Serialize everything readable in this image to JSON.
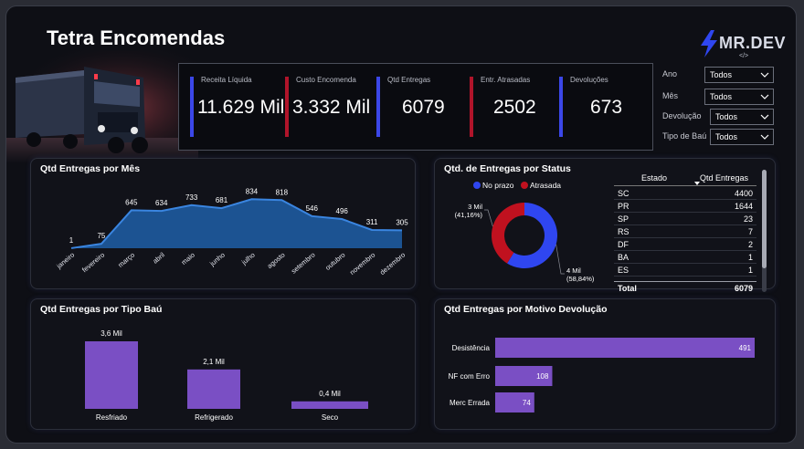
{
  "header": {
    "title": "Tetra Encomendas",
    "logo": "MR.DEV",
    "logo_sub": "</>"
  },
  "kpis": [
    {
      "label": "Receita Líquida",
      "value": "11.629 Mil",
      "color": "#3b47e8"
    },
    {
      "label": "Custo Encomenda",
      "value": "3.332 Mil",
      "color": "#b0142a"
    },
    {
      "label": "Qtd Entregas",
      "value": "6079",
      "color": "#3b47e8"
    },
    {
      "label": "Entr. Atrasadas",
      "value": "2502",
      "color": "#b0142a"
    },
    {
      "label": "Devoluções",
      "value": "673",
      "color": "#3b47e8"
    }
  ],
  "filters": [
    {
      "label": "Ano",
      "value": "Todos"
    },
    {
      "label": "Mês",
      "value": "Todos"
    },
    {
      "label": "Devolução",
      "value": "Todos"
    },
    {
      "label": "Tipo de Baú",
      "value": "Todos"
    }
  ],
  "panels": {
    "monthly": {
      "title": "Qtd Entregas por Mês"
    },
    "status": {
      "title": "Qtd. de Entregas por Status"
    },
    "tipo": {
      "title": "Qtd Entregas por Tipo Baú"
    },
    "motivo": {
      "title": "Qtd Entregas por Motivo Devolução"
    }
  },
  "chart_data": [
    {
      "type": "area",
      "title": "Qtd Entregas por Mês",
      "categories": [
        "janeiro",
        "fevereiro",
        "março",
        "abril",
        "maio",
        "junho",
        "julho",
        "agosto",
        "setembro",
        "outubro",
        "novembro",
        "dezembro"
      ],
      "values": [
        1,
        75,
        645,
        634,
        733,
        681,
        834,
        818,
        546,
        496,
        311,
        305
      ],
      "ylim": [
        0,
        900
      ],
      "color": "#1f5fa8",
      "grid": false
    },
    {
      "type": "pie",
      "title": "Qtd. de Entregas por Status",
      "legend": "top",
      "slices": [
        {
          "name": "No prazo",
          "value": 3577,
          "label": "4 Mil",
          "pct": "(58,84%)",
          "color": "#2f46f0"
        },
        {
          "name": "Atrasada",
          "value": 2502,
          "label": "3 Mil",
          "pct": "(41,16%)",
          "color": "#c0111f"
        }
      ]
    },
    {
      "type": "table",
      "columns": [
        "Estado",
        "Qtd Entregas"
      ],
      "rows": [
        [
          "SC",
          "4400"
        ],
        [
          "PR",
          "1644"
        ],
        [
          "SP",
          "23"
        ],
        [
          "RS",
          "7"
        ],
        [
          "DF",
          "2"
        ],
        [
          "BA",
          "1"
        ],
        [
          "ES",
          "1"
        ]
      ],
      "total": [
        "Total",
        "6079"
      ]
    },
    {
      "type": "bar",
      "title": "Qtd Entregas por Tipo Baú",
      "categories": [
        "Resfriado",
        "Refrigerado",
        "Seco"
      ],
      "values": [
        3600,
        2100,
        400
      ],
      "labels": [
        "3,6 Mil",
        "2,1 Mil",
        "0,4 Mil"
      ],
      "color": "#7a4fc4"
    },
    {
      "type": "bar",
      "orientation": "horizontal",
      "title": "Qtd Entregas por Motivo Devolução",
      "categories": [
        "Desistência",
        "NF com Erro",
        "Merc Errada"
      ],
      "values": [
        491,
        108,
        74
      ],
      "color": "#7a4fc4"
    }
  ]
}
